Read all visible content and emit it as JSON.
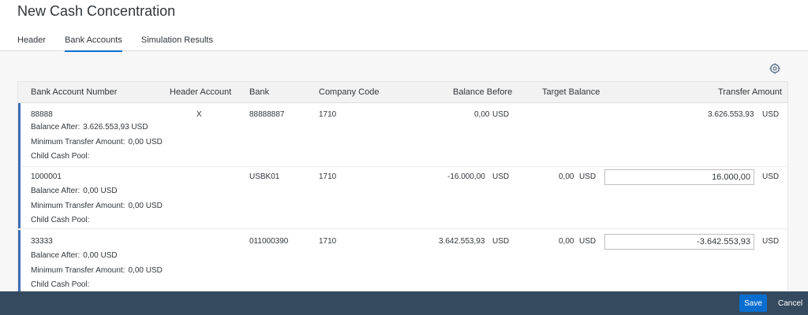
{
  "page": {
    "title": "New Cash Concentration"
  },
  "tabs": [
    {
      "label": "Header"
    },
    {
      "label": "Bank Accounts"
    },
    {
      "label": "Simulation Results"
    }
  ],
  "icons": {
    "settings": "gear-icon"
  },
  "table": {
    "headers": {
      "bank_account_number": "Bank Account Number",
      "header_account": "Header Account",
      "bank": "Bank",
      "company_code": "Company Code",
      "balance_before": "Balance Before",
      "target_balance": "Target Balance",
      "transfer_amount": "Transfer Amount"
    },
    "rows": [
      {
        "account": "88888",
        "header_account": "X",
        "bank": "88888887",
        "company_code": "1710",
        "balance_before": "0,00",
        "balance_before_currency": "USD",
        "target_balance": "",
        "target_currency": "",
        "transfer_amount": "3.626.553,93",
        "transfer_currency": "USD",
        "balance_after_label": "Balance After:",
        "balance_after_value": "3.626.553,93  USD",
        "min_transfer_label": "Minimum Transfer Amount:",
        "min_transfer_value": "0,00  USD",
        "child_pool_label": "Child Cash Pool:"
      },
      {
        "account": "1000001",
        "header_account": "",
        "bank": "USBK01",
        "company_code": "1710",
        "balance_before": "-16.000,00",
        "balance_before_currency": "USD",
        "target_balance": "0,00",
        "target_currency": "USD",
        "transfer_amount": "16.000,00",
        "transfer_currency": "USD",
        "balance_after_label": "Balance After:",
        "balance_after_value": "0,00  USD",
        "min_transfer_label": "Minimum Transfer Amount:",
        "min_transfer_value": "0,00  USD",
        "child_pool_label": "Child Cash Pool:"
      },
      {
        "account": "33333",
        "header_account": "",
        "bank": "011000390",
        "company_code": "1710",
        "balance_before": "3.642.553,93",
        "balance_before_currency": "USD",
        "target_balance": "0,00",
        "target_currency": "USD",
        "transfer_amount": "-3.642.553,93",
        "transfer_currency": "USD",
        "balance_after_label": "Balance After:",
        "balance_after_value": "0,00  USD",
        "min_transfer_label": "Minimum Transfer Amount:",
        "min_transfer_value": "0,00  USD",
        "child_pool_label": "Child Cash Pool:"
      }
    ]
  },
  "footer": {
    "save_label": "Save",
    "cancel_label": "Cancel"
  }
}
